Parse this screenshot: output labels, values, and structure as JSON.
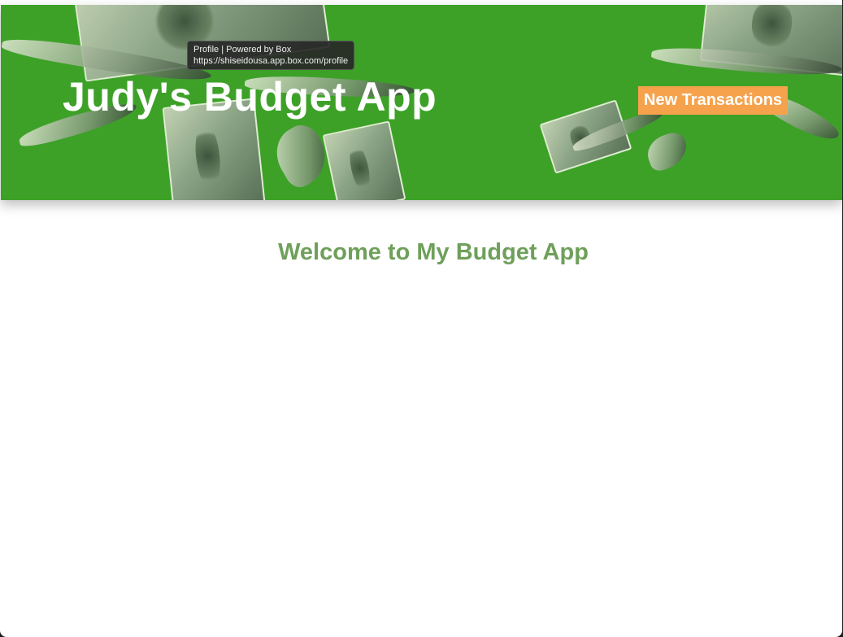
{
  "tooltip": {
    "title": "Profile | Powered by Box",
    "url": "https://shiseidousa.app.box.com/profile"
  },
  "header": {
    "title": "Judy's Budget App",
    "new_transactions_label": "New Transactions",
    "background_color": "#3da128",
    "button_color": "#f6a24c"
  },
  "main": {
    "welcome": "Welcome to My Budget App",
    "welcome_color": "#6fa05a"
  },
  "icons": {
    "decoration": "flying-money-icon"
  }
}
